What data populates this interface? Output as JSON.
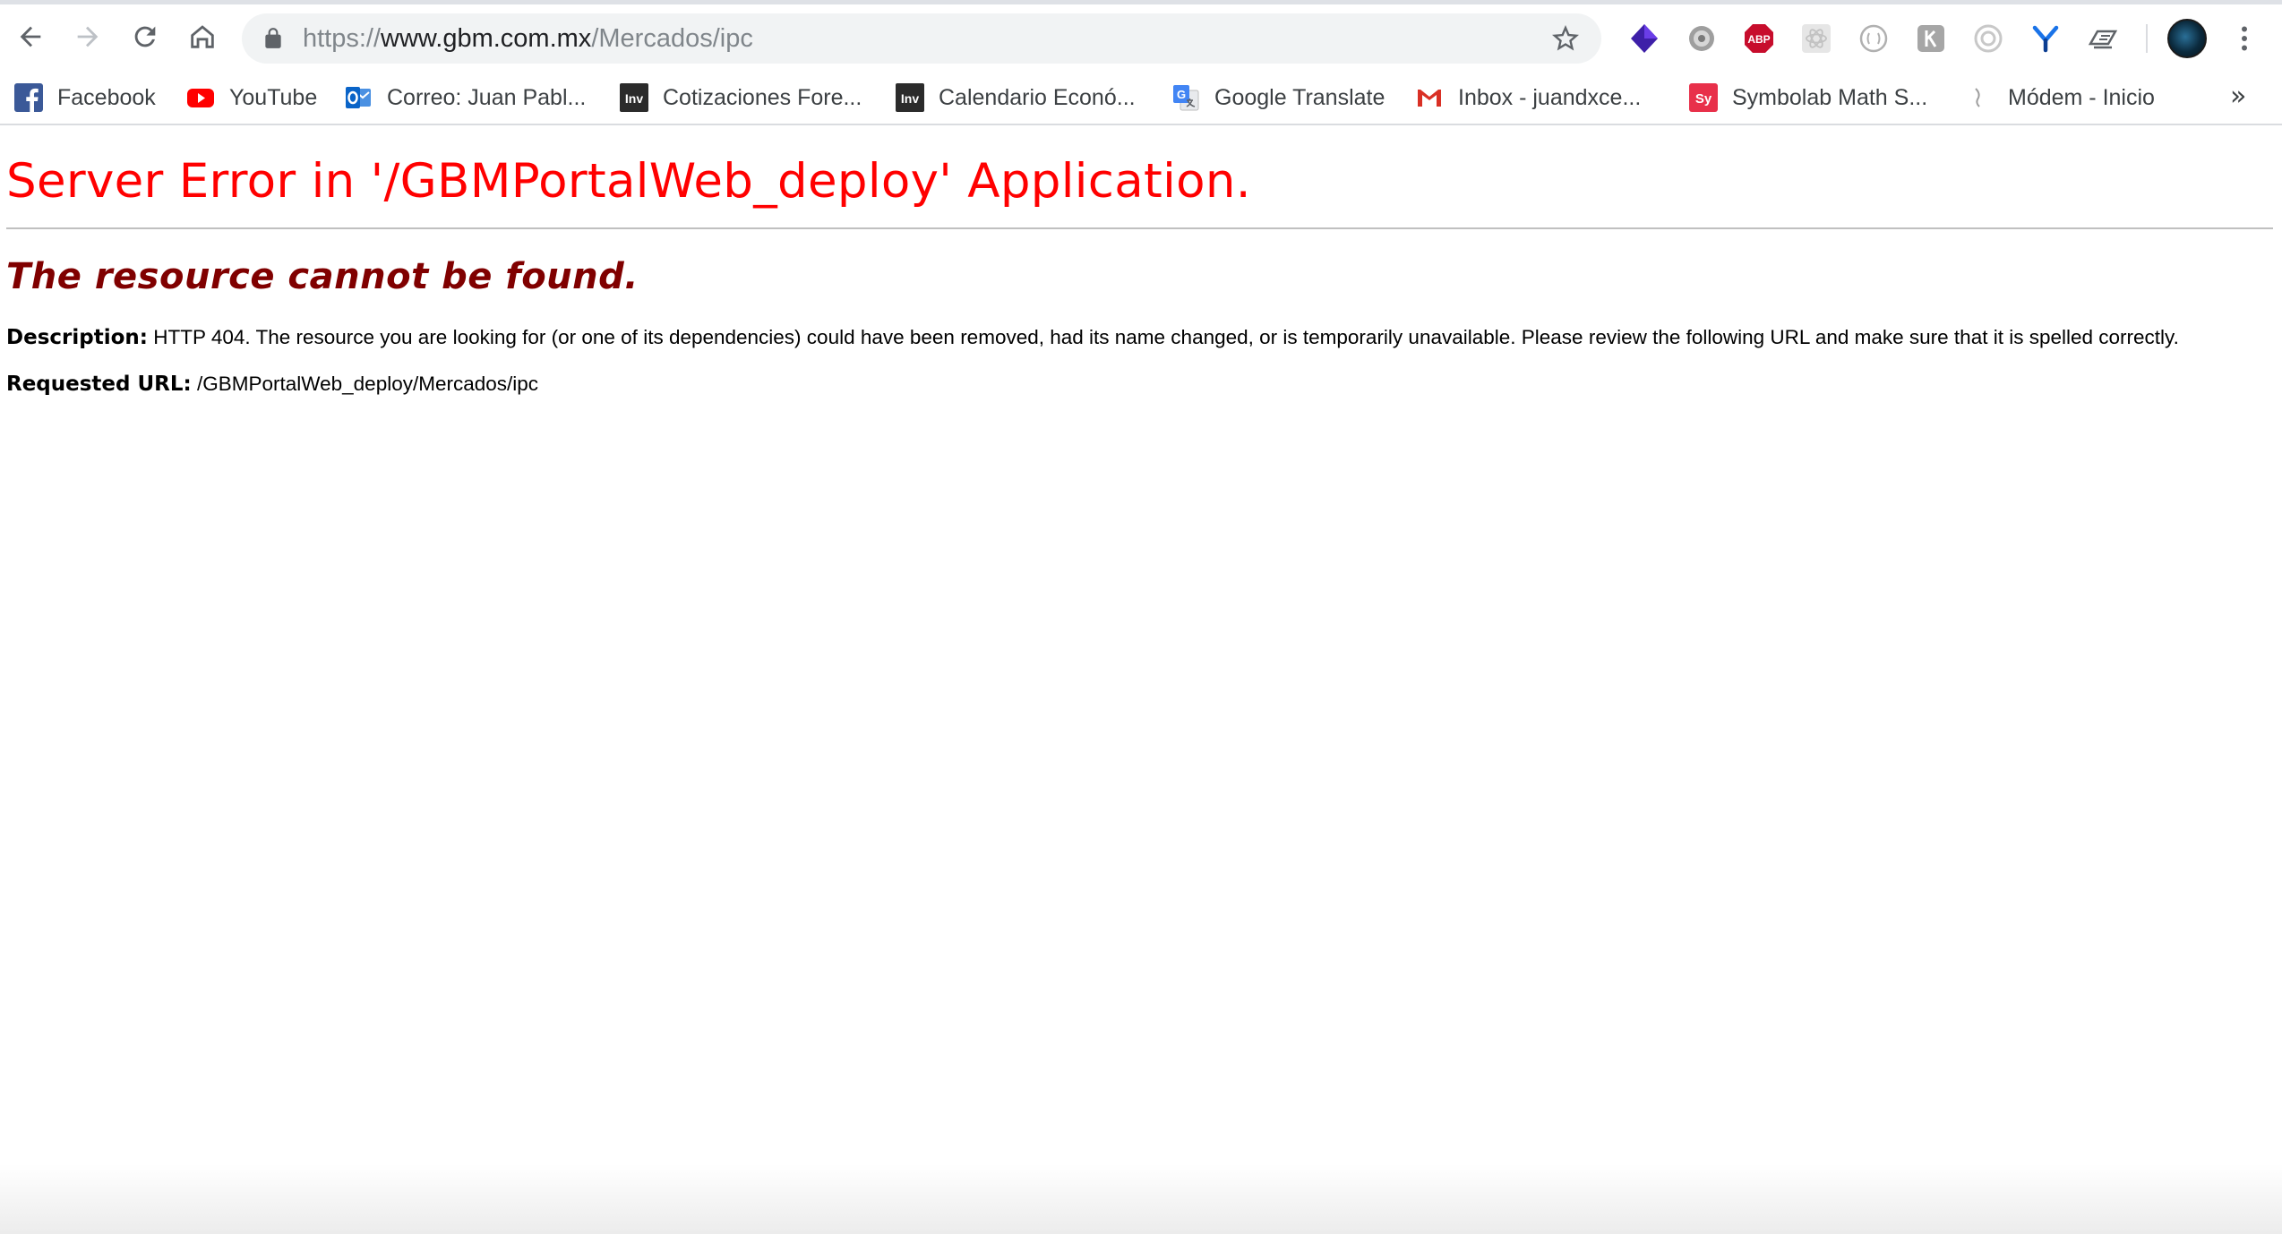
{
  "browser": {
    "url": {
      "scheme": "https://",
      "host": "www.gbm.com.mx",
      "path": "/Mercados/ipc"
    },
    "toolbar_icons": [
      "back-icon",
      "forward-icon",
      "reload-icon",
      "home-icon",
      "lock-icon",
      "star-icon"
    ],
    "extensions": [
      "purple-cube-extension-icon",
      "gear-extension-icon",
      "adblock-plus-icon",
      "react-extension-icon",
      "ext-circle-icon",
      "ext-k-icon",
      "ext-target-icon",
      "ext-y-icon",
      "ext-book-icon"
    ],
    "adblock_text": "ABP"
  },
  "bookmarks": [
    {
      "label": "Facebook",
      "icon": "facebook-icon"
    },
    {
      "label": "YouTube",
      "icon": "youtube-icon"
    },
    {
      "label": "Correo: Juan Pabl...",
      "icon": "outlook-icon"
    },
    {
      "label": "Cotizaciones Fore...",
      "icon": "investing-icon"
    },
    {
      "label": "Calendario Econó...",
      "icon": "investing-icon"
    },
    {
      "label": "Google Translate",
      "icon": "google-translate-icon"
    },
    {
      "label": "Inbox - juandxce...",
      "icon": "gmail-icon"
    },
    {
      "label": "Symbolab Math S...",
      "icon": "symbolab-icon"
    },
    {
      "label": "Módem - Inicio",
      "icon": "modem-icon"
    }
  ],
  "bookmark_icon_text": {
    "investing": "Inv",
    "symbolab": "Sy",
    "overflow": "»"
  },
  "page": {
    "title": "Server Error in '/GBMPortalWeb_deploy' Application.",
    "subtitle": "The resource cannot be found.",
    "description_label": "Description:",
    "description_text": "HTTP 404. The resource you are looking for (or one of its dependencies) could have been removed, had its name changed, or is temporarily unavailable.  Please review the following URL and make sure that it is spelled correctly.",
    "requested_url_label": "Requested URL:",
    "requested_url_value": "/GBMPortalWeb_deploy/Mercados/ipc"
  },
  "colors": {
    "title_red": "#ff0000",
    "subtitle_maroon": "#800000",
    "omnibox_bg": "#f1f3f4",
    "facebook_blue": "#1877f2",
    "youtube_red": "#ff0000",
    "adblock_red": "#c70d2c",
    "symbolab_red": "#e8304a"
  }
}
